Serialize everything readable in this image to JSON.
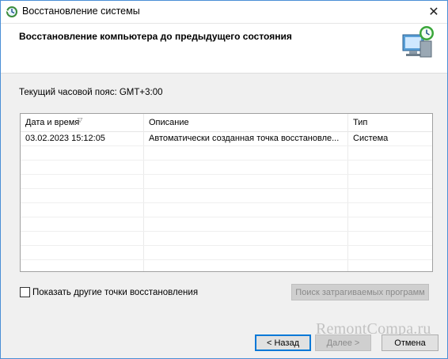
{
  "window": {
    "title": "Восстановление системы",
    "close_glyph": "✕"
  },
  "header": {
    "title": "Восстановление компьютера до предыдущего состояния",
    "icon": "system-restore-icon"
  },
  "timezone": {
    "label": "Текущий часовой пояс: GMT+3:00"
  },
  "restore_list": {
    "columns": [
      "Дата и время",
      "Описание",
      "Тип"
    ],
    "rows": [
      {
        "datetime": "03.02.2023 15:12:05",
        "description": "Автоматически созданная точка восстановле...",
        "type": "Система"
      }
    ]
  },
  "show_more": {
    "label": "Показать другие точки восстановления",
    "checked": false
  },
  "buttons": {
    "scan": "Поиск затрагиваемых программ",
    "back": "< Назад",
    "next": "Далее >",
    "cancel": "Отмена"
  },
  "watermark": "RemontCompa.ru",
  "colors": {
    "accent": "#0078d7",
    "window_border": "#4a8fd6"
  }
}
